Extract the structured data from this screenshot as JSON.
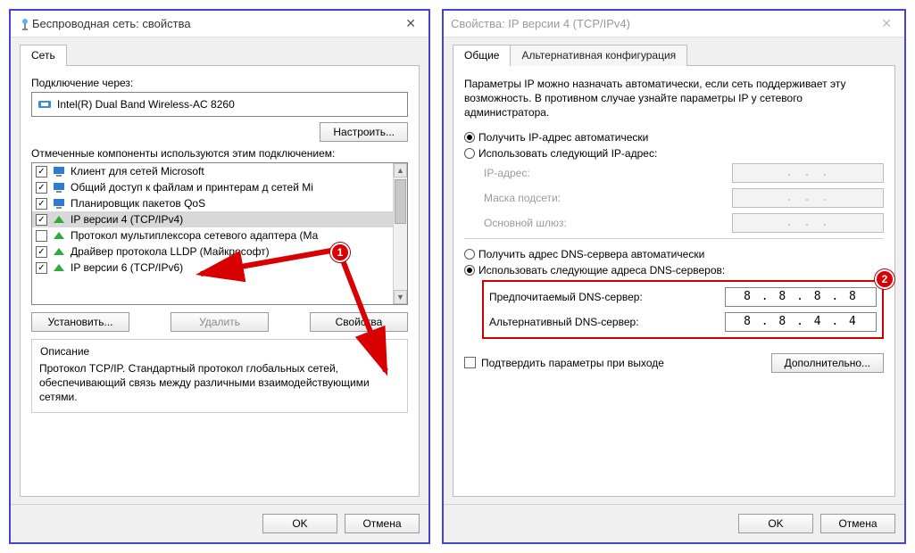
{
  "left": {
    "title": "Беспроводная сеть: свойства",
    "tab_network": "Сеть",
    "connect_label": "Подключение через:",
    "adapter": "Intel(R) Dual Band Wireless-AC 8260",
    "configure_btn": "Настроить...",
    "components_label": "Отмеченные компоненты используются этим подключением:",
    "items": [
      {
        "checked": true,
        "label": "Клиент для сетей Microsoft"
      },
      {
        "checked": true,
        "label": "Общий доступ к файлам и принтерам д   сетей Mi"
      },
      {
        "checked": true,
        "label": "Планировщик пакетов QoS"
      },
      {
        "checked": true,
        "label": "IP версии 4 (TCP/IPv4)"
      },
      {
        "checked": false,
        "label": "Протокол мультиплексора сетевого адаптера  (Ма"
      },
      {
        "checked": true,
        "label": "Драйвер протокола LLDP (Майкрософт)"
      },
      {
        "checked": true,
        "label": "IP версии 6 (TCP/IPv6)"
      }
    ],
    "install_btn": "Установить...",
    "remove_btn": "Удалить",
    "properties_btn": "Свойства",
    "desc_legend": "Описание",
    "desc_text": "Протокол TCP/IP. Стандартный протокол глобальных сетей, обеспечивающий связь между различными взаимодействующими сетями.",
    "ok": "OK",
    "cancel": "Отмена"
  },
  "right": {
    "title": "Свойства: IP версии 4 (TCP/IPv4)",
    "tab_general": "Общие",
    "tab_alt": "Альтернативная конфигурация",
    "intro": "Параметры IP можно назначать автоматически, если сеть поддерживает эту возможность. В противном случае узнайте параметры IP у сетевого администратора.",
    "ip_auto": "Получить IP-адрес автоматически",
    "ip_manual": "Использовать следующий IP-адрес:",
    "ip_label": "IP-адрес:",
    "mask_label": "Маска подсети:",
    "gw_label": "Основной шлюз:",
    "dots": ".       .       .",
    "dns_auto": "Получить адрес DNS-сервера автоматически",
    "dns_manual": "Использовать следующие адреса DNS-серверов:",
    "dns_pref_label": "Предпочитаемый DNS-сервер:",
    "dns_alt_label": "Альтернативный DNS-сервер:",
    "dns_pref_value": "8 . 8 . 8 . 8",
    "dns_alt_value": "8 . 8 . 4 . 4",
    "validate_label": "Подтвердить параметры при выходе",
    "advanced_btn": "Дополнительно...",
    "ok": "OK",
    "cancel": "Отмена"
  },
  "anno": {
    "one": "1",
    "two": "2"
  }
}
